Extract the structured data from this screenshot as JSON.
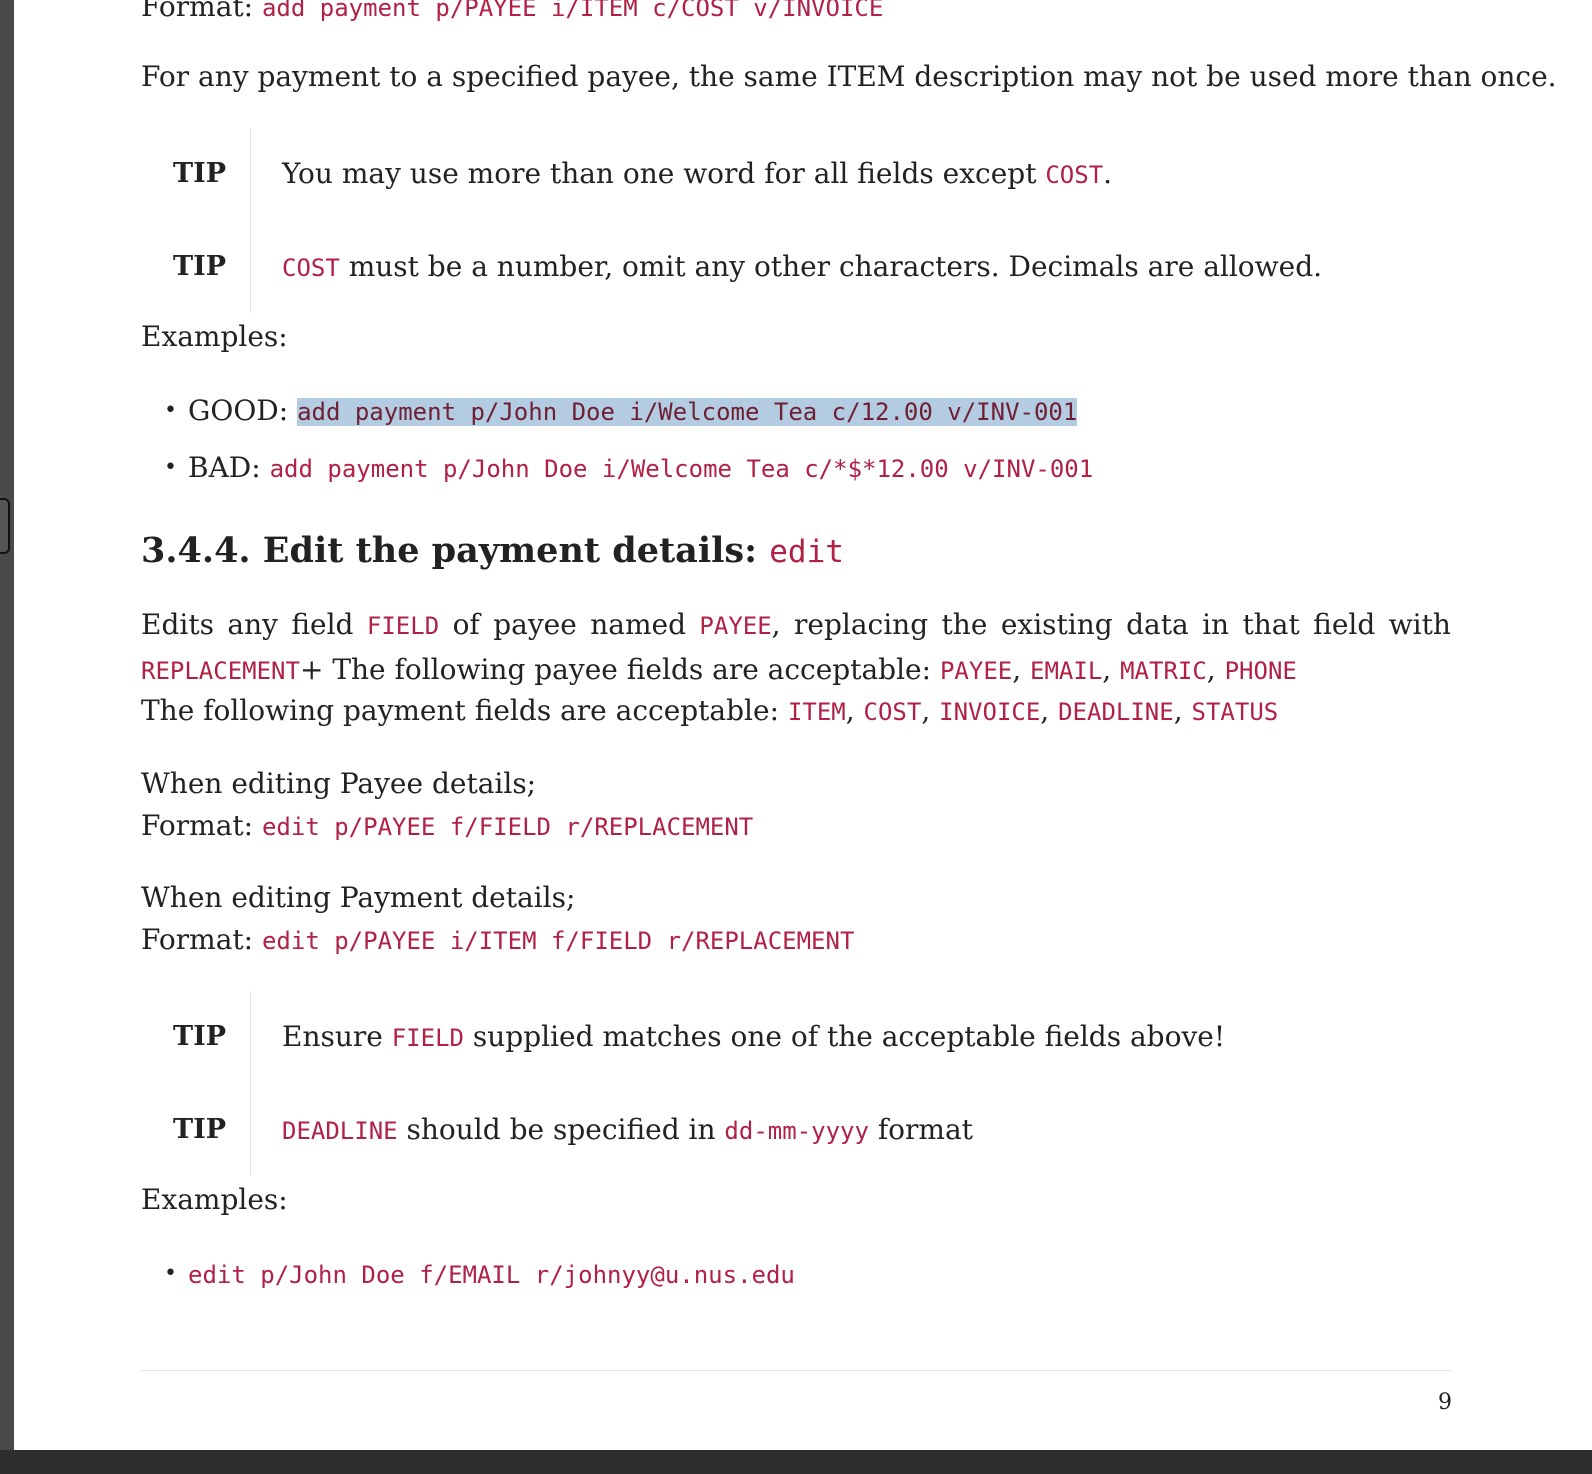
{
  "format_top": {
    "label": "Format:",
    "code": "add payment p/PAYEE i/ITEM c/COST v/INVOICE"
  },
  "item_rule": "For any payment to a specified payee, the same ITEM description may not be used more than once.",
  "tips_add": [
    {
      "label": "TIP",
      "pre": "You may use more than one word for all fields except ",
      "code": "COST",
      "post": "."
    },
    {
      "label": "TIP",
      "code": "COST",
      "post": " must be a number, omit any other characters. Decimals are allowed."
    }
  ],
  "examples_label": "Examples:",
  "examples_add": [
    {
      "prefix": "GOOD: ",
      "code": "add payment p/John Doe i/Welcome Tea c/12.00 v/INV-001"
    },
    {
      "prefix": "BAD: ",
      "code": "add payment p/John Doe i/Welcome Tea c/*$*12.00 v/INV-001"
    }
  ],
  "section": {
    "title": "3.4.4. Edit the payment details: ",
    "code": "edit"
  },
  "edit_desc": {
    "line1": {
      "w1": "Edits",
      "w2": "any",
      "w3": "field",
      "c1": "FIELD",
      "w4": "of",
      "w5": "payee",
      "w6": "named",
      "c2": "PAYEE",
      "w7": ",",
      "w8": "replacing",
      "w9": "the",
      "w10": "existing",
      "w11": "data",
      "w12": "in",
      "w13": "that",
      "w14": "field",
      "w15": "with"
    },
    "line2": {
      "c1": "REPLACEMENT",
      "text": "+ The following payee fields are acceptable: ",
      "fields": [
        "PAYEE",
        "EMAIL",
        "MATRIC",
        "PHONE"
      ]
    },
    "line3": {
      "text": "The following payment fields are acceptable: ",
      "fields": [
        "ITEM",
        "COST",
        "INVOICE",
        "DEADLINE",
        "STATUS"
      ]
    }
  },
  "payee_edit": {
    "intro": "When editing Payee details;",
    "label": "Format:",
    "code": "edit p/PAYEE f/FIELD r/REPLACEMENT"
  },
  "payment_edit": {
    "intro": "When editing Payment details;",
    "label": "Format:",
    "code": "edit p/PAYEE i/ITEM f/FIELD r/REPLACEMENT"
  },
  "tips_edit": [
    {
      "label": "TIP",
      "pre": "Ensure ",
      "code": "FIELD",
      "post": " supplied matches one of the acceptable fields above!"
    },
    {
      "label": "TIP",
      "code": "DEADLINE",
      "mid": " should be specified in ",
      "code2": "dd-mm-yyyy",
      "post": " format"
    }
  ],
  "examples_edit": [
    {
      "code": "edit p/John Doe f/EMAIL r/johnyy@u.nus.edu"
    }
  ],
  "page_number": "9"
}
